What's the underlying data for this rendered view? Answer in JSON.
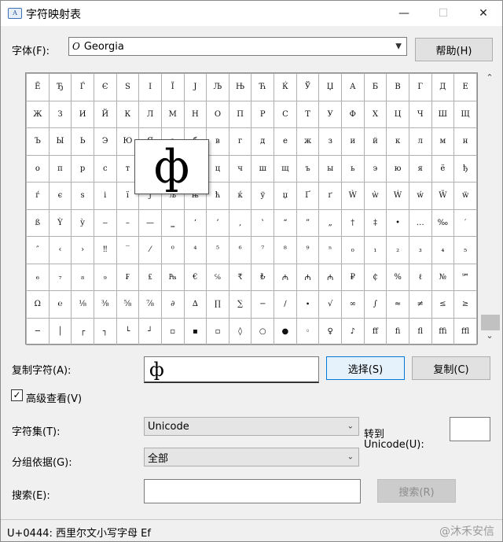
{
  "window": {
    "title": "字符映射表"
  },
  "font": {
    "label": "字体(F):",
    "value": "Georgia",
    "help_button": "帮助(H)"
  },
  "grid": {
    "rows": [
      [
        "Ё",
        "Ђ",
        "Ѓ",
        "Є",
        "S",
        "І",
        "Ї",
        "J",
        "Љ",
        "Њ",
        "Ћ",
        "Ќ",
        "Ў",
        "Џ",
        "А",
        "Б",
        "В",
        "Г",
        "Д",
        "Е"
      ],
      [
        "Ж",
        "З",
        "И",
        "Й",
        "К",
        "Л",
        "М",
        "Н",
        "О",
        "П",
        "Р",
        "С",
        "Т",
        "У",
        "Ф",
        "Х",
        "Ц",
        "Ч",
        "Ш",
        "Щ"
      ],
      [
        "Ъ",
        "Ы",
        "Ь",
        "Э",
        "Ю",
        "Я",
        "а",
        "б",
        "в",
        "г",
        "д",
        "е",
        "ж",
        "з",
        "и",
        "й",
        "к",
        "л",
        "м",
        "н"
      ],
      [
        "о",
        "п",
        "р",
        "с",
        "т",
        "у",
        "ф",
        "х",
        "ц",
        "ч",
        "ш",
        "щ",
        "ъ",
        "ы",
        "ь",
        "э",
        "ю",
        "я",
        "ё",
        "ђ"
      ],
      [
        "ѓ",
        "є",
        "ѕ",
        "і",
        "ї",
        "ј",
        "љ",
        "њ",
        "ћ",
        "ќ",
        "ў",
        "џ",
        "Ґ",
        "ґ",
        "Ẁ",
        "ẁ",
        "Ẃ",
        "ẃ",
        "Ẅ",
        "ẅ"
      ],
      [
        "ß",
        "Ỳ",
        "ỳ",
        "‒",
        "–",
        "—",
        "‗",
        "‘",
        "’",
        "‚",
        "‛",
        "“",
        "”",
        "„",
        "†",
        "‡",
        "•",
        "…",
        "‰",
        "′"
      ],
      [
        "″",
        "‹",
        "›",
        "‼",
        "‾",
        "⁄",
        "⁰",
        "⁴",
        "⁵",
        "⁶",
        "⁷",
        "⁸",
        "⁹",
        "ⁿ",
        "₀",
        "₁",
        "₂",
        "₃",
        "₄",
        "₅"
      ],
      [
        "₆",
        "₇",
        "₈",
        "₉",
        "₣",
        "₤",
        "₧",
        "€",
        "℅",
        "₹",
        "₺",
        "₼",
        "₼",
        "₼",
        "₽",
        "₵",
        "%",
        "ℓ",
        "№",
        "℠",
        "™"
      ],
      [
        "Ω",
        "℮",
        "⅛",
        "⅜",
        "⅝",
        "⅞",
        "∂",
        "∆",
        "∏",
        "∑",
        "−",
        "∕",
        "∙",
        "√",
        "∞",
        "∫",
        "≈",
        "≠",
        "≤",
        "≥"
      ],
      [
        "─",
        "│",
        "┌",
        "┐",
        "└",
        "┘",
        "▫",
        "▪",
        "▫",
        "◊",
        "○",
        "●",
        "◦",
        "♀",
        "♪",
        "ﬀ",
        "ﬁ",
        "ﬂ",
        "ﬃ",
        "ﬄ"
      ]
    ],
    "zoom_char": "ф"
  },
  "copy": {
    "label": "复制字符(A):",
    "value": "ф",
    "select_button": "选择(S)",
    "copy_button": "复制(C)"
  },
  "advanced": {
    "label": "高级查看(V)",
    "checked": "✓"
  },
  "charset": {
    "label": "字符集(T):",
    "value": "Unicode"
  },
  "goto": {
    "label_line1": "转到",
    "label_line2": "Unicode(U):",
    "value": ""
  },
  "groupby": {
    "label": "分组依据(G):",
    "value": "全部"
  },
  "search": {
    "label": "搜索(E):",
    "value": "",
    "button": "搜索(R)"
  },
  "status": {
    "text": "U+0444: 西里尔文小写字母 Ef",
    "watermark": "@沐禾安信"
  }
}
